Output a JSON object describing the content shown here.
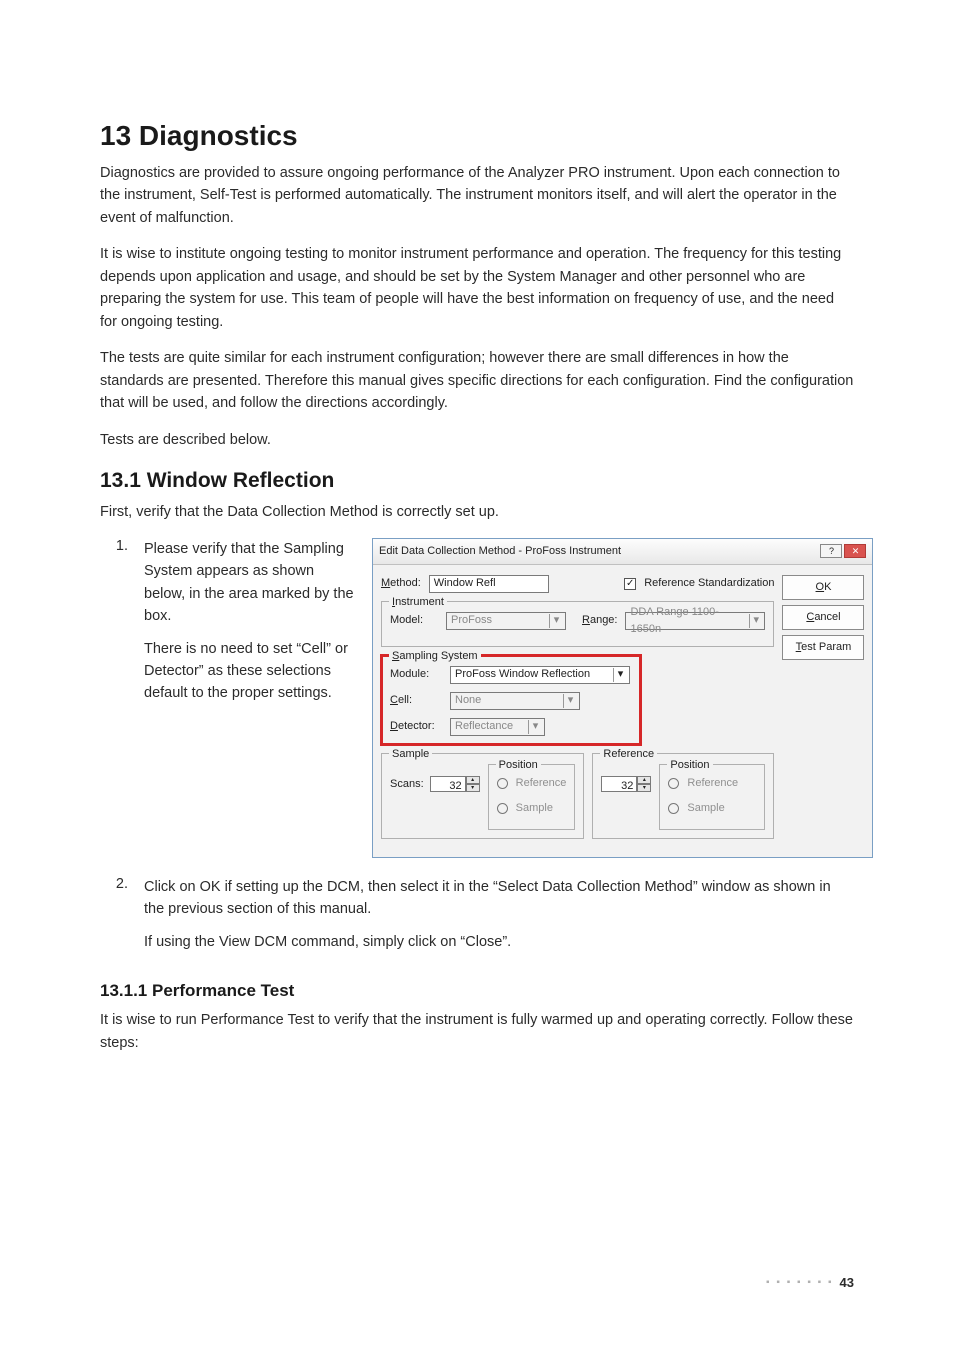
{
  "h1": "13 Diagnostics",
  "p1": "Diagnostics are provided to assure ongoing performance of the Analyzer PRO instrument. Upon each connection to the instrument, Self-Test is performed automatically. The instrument monitors itself, and will alert the operator in the event of malfunction.",
  "p2": "It is wise to institute ongoing testing to monitor instrument performance and operation. The frequency for this testing depends upon application and usage, and should be set by the System Manager and other personnel who are preparing the system for use. This team of people will have the best information on frequency of use, and the need for ongoing testing.",
  "p3": "The tests are quite similar for each instrument configuration; however there are small differences in how the standards are presented. Therefore this manual gives specific directions for each configuration. Find the configuration that will be used, and follow the directions accordingly.",
  "p4": "Tests are described below.",
  "h2": "13.1 Window Reflection",
  "p5": "First, verify that the Data Collection Method is correctly set up.",
  "step1_num": "1.",
  "step1_t1": "Please verify that the Sampling System appears as shown below, in the area marked by the box.",
  "step1_t2": "There is no need to set “Cell” or Detector” as these selections default to the proper settings.",
  "step2_num": "2.",
  "step2_t1": "Click on OK if setting up the DCM, then select it in the “Select Data Collection Method” window as shown in the previous section of this manual.",
  "step2_t2": "If using the View DCM command, simply click on “Close”.",
  "h3": "13.1.1  Performance Test",
  "p6": "It is wise to run Performance Test to verify that the instrument is fully warmed up and operating correctly. Follow these steps:",
  "page_num": "43",
  "dots": "▪ ▪ ▪ ▪ ▪ ▪ ▪",
  "dialog": {
    "title": "Edit Data Collection Method - ProFoss Instrument",
    "help_btn": "?",
    "close_btn": "✕",
    "method_lbl_pre": "M",
    "method_lbl_post": "ethod:",
    "method_val": "Window Refl",
    "refstd_lbl": "Reference Standardization",
    "ok": "OK",
    "ok_u": "O",
    "ok_rest": "K",
    "cancel_u": "C",
    "cancel_rest": "ancel",
    "test_u": "T",
    "test_rest": "est Param",
    "instrument_legend_u": "I",
    "instrument_legend_rest": "nstrument",
    "model_lbl": "Model:",
    "model_val": "ProFoss",
    "range_u": "R",
    "range_rest": "ange:",
    "range_val": "DDA Range 1100-1650n",
    "sampling_legend_u": "S",
    "sampling_legend_rest": "ampling System",
    "module_lbl": "Module:",
    "module_val": "ProFoss Window Reflection",
    "cell_u": "C",
    "cell_rest": "ell:",
    "cell_val": "None",
    "detector_u": "D",
    "detector_rest": "etector:",
    "detector_val": "Reflectance",
    "sample_legend": "Sample",
    "scans_lbl": "Scans:",
    "scans_val": "32",
    "position_legend": "Position",
    "radio_ref": "Reference",
    "radio_sample": "Sample",
    "reference_legend": "Reference",
    "ref_scans_val": "32"
  }
}
